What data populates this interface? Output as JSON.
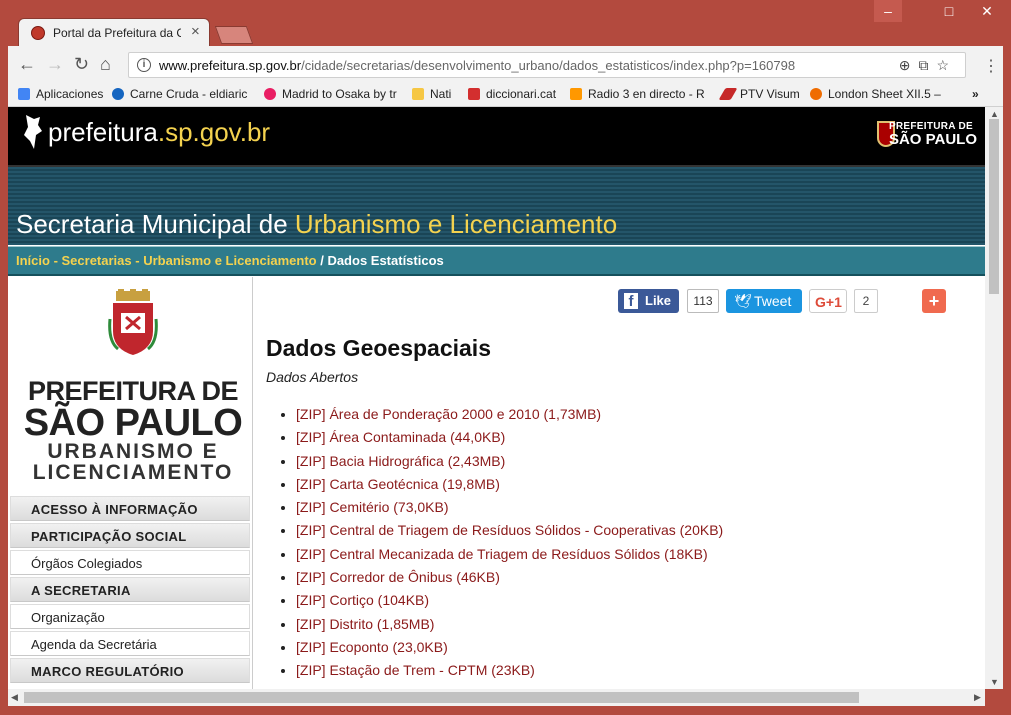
{
  "browser": {
    "tab_title": "Portal da Prefeitura da Ci",
    "url_host": "www.prefeitura.sp.gov.br",
    "url_path": "/cidade/secretarias/desenvolvimento_urbano/dados_estatisticos/index.php?p=160798",
    "bookmarks": [
      {
        "label": "Aplicaciones",
        "color": "#4285f4"
      },
      {
        "label": "Carne Cruda - eldiaric",
        "color": "#1565c0"
      },
      {
        "label": "Madrid to Osaka by tr",
        "color": "#e91e63"
      },
      {
        "label": "Nati",
        "color": "#f6c744"
      },
      {
        "label": "diccionari.cat",
        "color": "#d32f2f"
      },
      {
        "label": "Radio 3 en directo - R",
        "color": "#ff9800"
      },
      {
        "label": "PTV Visum",
        "color": "#c62828"
      },
      {
        "label": "London Sheet XII.5 –",
        "color": "#ef6c00"
      }
    ],
    "more_bookmarks": "»"
  },
  "site": {
    "logo_host": "prefeitura",
    "logo_domain": ".sp.gov.br",
    "brand_small": "PREFEITURA DE",
    "brand_big": "SÃO PAULO",
    "banner_prefix": "Secretaria Municipal de ",
    "banner_highlight": "Urbanismo e Licenciamento",
    "breadcrumb": {
      "inicio": "Início",
      "sep1": " - ",
      "secretarias": "Secretarias",
      "sep2": " - ",
      "urbanismo": "Urbanismo e Licenciamento",
      "sep3": " / ",
      "current": "Dados Estatísticos"
    }
  },
  "sidebar": {
    "logo_line1": "PREFEITURA DE",
    "logo_line2": "SÃO PAULO",
    "logo_line3": "URBANISMO E",
    "logo_line4": "LICENCIAMENTO",
    "menu": [
      {
        "label": "ACESSO À INFORMAÇÃO",
        "type": "head"
      },
      {
        "label": "PARTICIPAÇÃO SOCIAL",
        "type": "head"
      },
      {
        "label": "Órgãos Colegiados",
        "type": "sub"
      },
      {
        "label": "A SECRETARIA",
        "type": "head"
      },
      {
        "label": "Organização",
        "type": "sub"
      },
      {
        "label": "Agenda da Secretária",
        "type": "sub"
      },
      {
        "label": "MARCO REGULATÓRIO",
        "type": "head"
      }
    ]
  },
  "social": {
    "like_label": "Like",
    "like_count": "113",
    "tweet_label": "Tweet",
    "gplus_label": "G+1",
    "gplus_count": "2",
    "share_label": "+"
  },
  "main": {
    "title": "Dados Geoespaciais",
    "subtitle": "Dados Abertos",
    "files": [
      "[ZIP] Área de Ponderação 2000 e 2010 (1,73MB)",
      "[ZIP] Área Contaminada (44,0KB)",
      "[ZIP] Bacia Hidrográfica (2,43MB)",
      "[ZIP] Carta Geotécnica (19,8MB)",
      "[ZIP] Cemitério (73,0KB)",
      "[ZIP] Central de Triagem de Resíduos Sólidos - Cooperativas (20KB)",
      "[ZIP] Central Mecanizada de Triagem de Resíduos Sólidos (18KB)",
      "[ZIP] Corredor de Ônibus (46KB)",
      "[ZIP] Cortiço (104KB)",
      "[ZIP] Distrito (1,85MB)",
      "[ZIP] Ecoponto (23,0KB)",
      "[ZIP] Estação de Trem - CPTM (23KB)"
    ]
  }
}
